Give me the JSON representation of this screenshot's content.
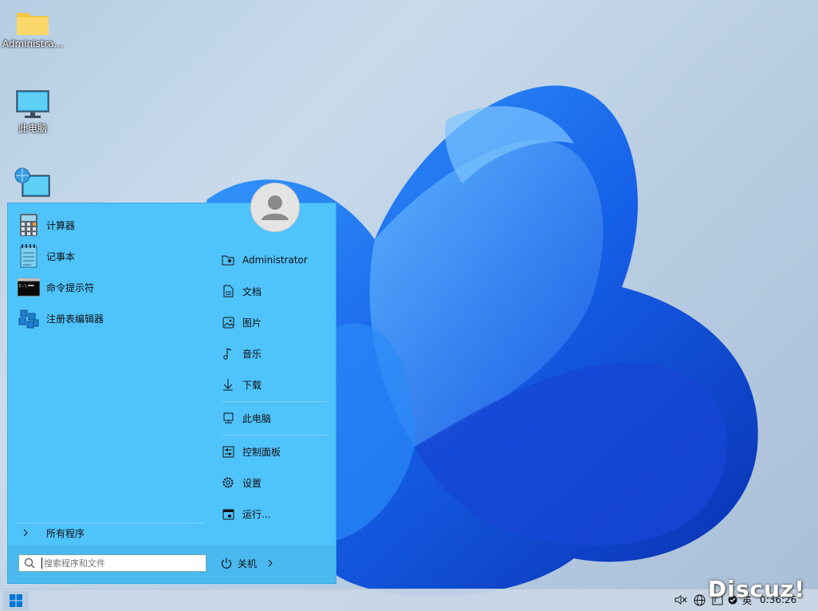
{
  "desktop": {
    "icons": [
      {
        "label": "Administra...",
        "icon": "folder-icon"
      },
      {
        "label": "此电脑",
        "icon": "computer-icon"
      },
      {
        "label": "",
        "icon": "network-icon"
      }
    ]
  },
  "start_menu": {
    "apps": [
      {
        "label": "计算器",
        "icon": "calculator-icon"
      },
      {
        "label": "记事本",
        "icon": "notepad-icon"
      },
      {
        "label": "命令提示符",
        "icon": "cmd-icon"
      },
      {
        "label": "注册表编辑器",
        "icon": "regedit-icon"
      }
    ],
    "places": [
      {
        "label": "Administrator",
        "icon": "user-folder-icon"
      },
      {
        "label": "文档",
        "icon": "document-icon"
      },
      {
        "label": "图片",
        "icon": "picture-icon"
      },
      {
        "label": "音乐",
        "icon": "music-icon"
      },
      {
        "label": "下载",
        "icon": "download-icon"
      },
      {
        "label": "此电脑",
        "icon": "computer-icon"
      },
      {
        "label": "控制面板",
        "icon": "control-panel-icon"
      },
      {
        "label": "设置",
        "icon": "settings-icon"
      },
      {
        "label": "运行...",
        "icon": "run-icon"
      }
    ],
    "all_programs_label": "所有程序",
    "search_placeholder": "搜索程序和文件",
    "shutdown_label": "关机"
  },
  "taskbar": {
    "tray_time": "0:36:26",
    "ime_label": "英"
  },
  "watermark": "Discuz!",
  "colors": {
    "start_menu_bg": "#4fc3fc",
    "accent": "#0078d4"
  }
}
